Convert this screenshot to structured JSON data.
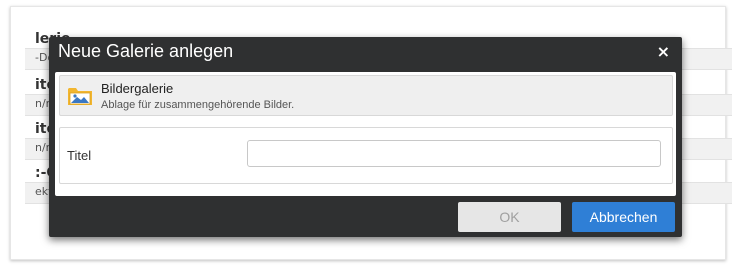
{
  "background_page": {
    "rows": [
      {
        "title": "lerie",
        "subtitle": "-Do"
      },
      {
        "title": "iter",
        "subtitle": "n/me"
      },
      {
        "title": "iter",
        "subtitle": "n/me"
      },
      {
        "title": ":-Ga",
        "subtitle": "ekte"
      }
    ]
  },
  "dialog": {
    "title": "Neue Galerie anlegen",
    "close_symbol": "×",
    "gallery_type": {
      "icon": "folder-image-icon",
      "title": "Bildergalerie",
      "description": "Ablage für zusammengehörende Bilder."
    },
    "field": {
      "label": "Titel",
      "value": "",
      "placeholder": ""
    },
    "buttons": {
      "ok_label": "OK",
      "cancel_label": "Abbrechen"
    }
  },
  "colors": {
    "dialog_bg": "#2f3031",
    "primary_button": "#2f7fd6",
    "disabled_button": "#e6e6e6"
  }
}
